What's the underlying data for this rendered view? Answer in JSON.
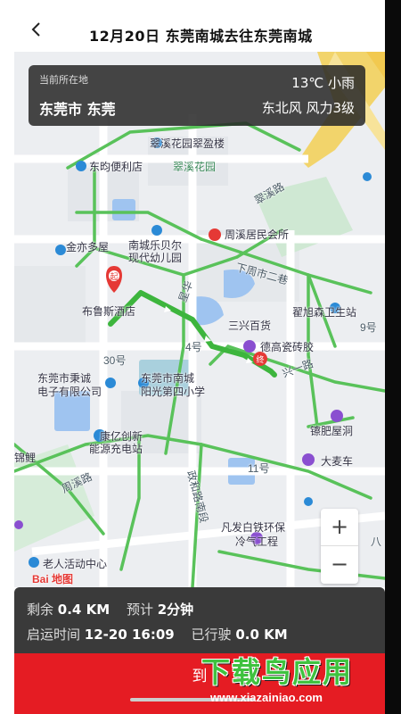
{
  "header": {
    "title": "12月20日 东莞南城去往东莞南城"
  },
  "info_card": {
    "location_label": "当前所在地",
    "city": "东莞市 东莞",
    "weather": "13℃ 小雨",
    "wind": "东北风 风力3级"
  },
  "map": {
    "labels": {
      "cuixi_hotel": "翠溪花园翠盈楼",
      "dongyun": "东昀便利店",
      "cuixi_garden": "翠溪花园",
      "cuixi_road": "翠溪路",
      "jinyi": "金亦多屋",
      "kindergarten_1": "南城乐贝尔",
      "kindergarten_2": "现代幼儿园",
      "zhoukei": "周溪居民会所",
      "xiazhou": "下周市二巷",
      "bulusi": "布鲁斯酒店",
      "xinghua": "星华",
      "sanxing": "三兴百货",
      "qu_clinic": "翟旭森卫生站",
      "num9": "9号",
      "dehao": "德高瓷砖胶",
      "num4": "4号",
      "num30": "30号",
      "chengyi_1": "东莞市秉诚",
      "chengyi_2": "电子有限公司",
      "school_1": "东莞市南城",
      "school_2": "阳光第四小学",
      "xingyi": "兴一路",
      "zhifei": "镲肥屋洞",
      "kangyi_1": "康亿创新",
      "kangyi_2": "能源充电站",
      "num11": "11号",
      "dama": "大麦车",
      "jinli": "锦鲤",
      "zhouxi_road": "周溪路",
      "zhengxiu": "政和路南段",
      "fanfa_1": "凡发白铁环保",
      "fanfa_2": "冷气工程",
      "elderly": "老人活动中心",
      "baidu": "Bai 地图",
      "num8": "八"
    },
    "zoom_in": "+",
    "zoom_out": "−"
  },
  "trip": {
    "remaining_label": "剩余",
    "remaining_value": "0.4 KM",
    "estimate_label": "预计",
    "estimate_value": "2分钟",
    "start_label": "启运时间",
    "start_value": "12-20 16:09",
    "traveled_label": "已行驶",
    "traveled_value": "0.0 KM",
    "action_button": "到"
  },
  "watermark": {
    "logo": "下载鸟应用",
    "url": "www.xiazainiao.com"
  },
  "colors": {
    "route": "#3db53d",
    "action": "#e51c23",
    "panel": "#3a3a3a"
  }
}
